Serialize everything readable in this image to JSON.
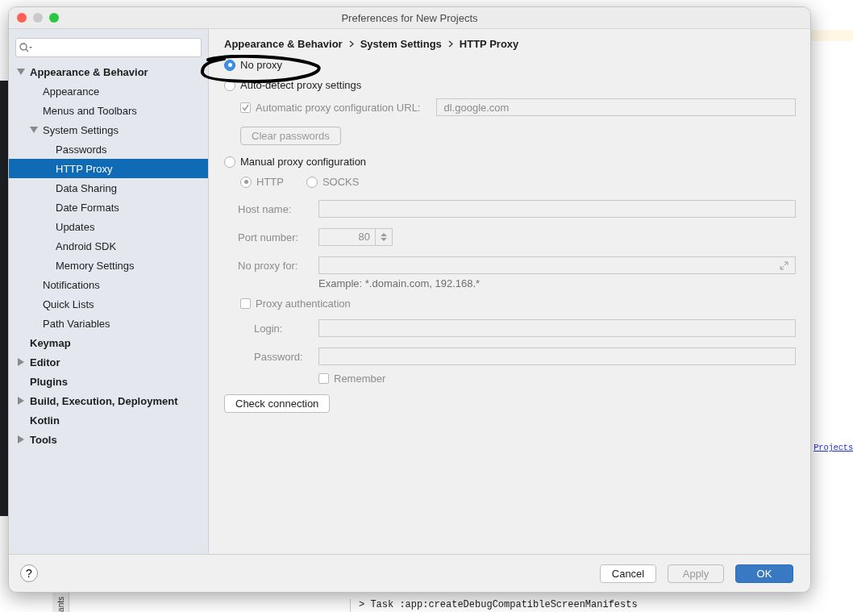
{
  "window": {
    "title": "Preferences for New Projects"
  },
  "sidebar": {
    "items": [
      {
        "label": "Appearance & Behavior",
        "selected": false,
        "expanded": true,
        "children": [
          {
            "label": "Appearance",
            "selected": false
          },
          {
            "label": "Menus and Toolbars",
            "selected": false
          },
          {
            "label": "System Settings",
            "selected": false,
            "expanded": true,
            "children": [
              {
                "label": "Passwords",
                "selected": false
              },
              {
                "label": "HTTP Proxy",
                "selected": true
              },
              {
                "label": "Data Sharing",
                "selected": false
              },
              {
                "label": "Date Formats",
                "selected": false
              },
              {
                "label": "Updates",
                "selected": false
              },
              {
                "label": "Android SDK",
                "selected": false
              },
              {
                "label": "Memory Settings",
                "selected": false
              }
            ]
          },
          {
            "label": "Notifications",
            "selected": false
          },
          {
            "label": "Quick Lists",
            "selected": false
          },
          {
            "label": "Path Variables",
            "selected": false
          }
        ]
      },
      {
        "label": "Keymap",
        "selected": false
      },
      {
        "label": "Editor",
        "selected": false,
        "expanded": false
      },
      {
        "label": "Plugins",
        "selected": false
      },
      {
        "label": "Build, Execution, Deployment",
        "selected": false,
        "expanded": false
      },
      {
        "label": "Kotlin",
        "selected": false
      },
      {
        "label": "Tools",
        "selected": false,
        "expanded": false
      }
    ]
  },
  "breadcrumb": [
    "Appearance & Behavior",
    "System Settings",
    "HTTP Proxy"
  ],
  "proxy_modes": [
    {
      "label": "No proxy",
      "selected": true
    },
    {
      "label": "Auto-detect proxy settings",
      "selected": false
    },
    {
      "label": "Manual proxy configuration",
      "selected": false
    }
  ],
  "auto_detect": {
    "disabled": true,
    "url_checkbox": {
      "label": "Automatic proxy configuration URL:",
      "checked": true
    },
    "url": {
      "value": "dl.google.com"
    },
    "clear_button": "Clear passwords"
  },
  "manual": {
    "disabled": true,
    "protocols": [
      {
        "label": "HTTP",
        "selected": true
      },
      {
        "label": "SOCKS",
        "selected": false
      }
    ],
    "host": {
      "label": "Host name:"
    },
    "port": {
      "label": "Port number:",
      "value": "80"
    },
    "no_proxy": {
      "label": "No proxy for:"
    },
    "example": "Example: *.domain.com, 192.168.*",
    "auth": {
      "label": "Proxy authentication",
      "checked": false
    },
    "login": {
      "label": "Login:"
    },
    "password": {
      "label": "Password:"
    },
    "remember": {
      "label": "Remember",
      "checked": false
    }
  },
  "check_button": "Check connection",
  "help": "?",
  "buttons": [
    {
      "label": "Cancel",
      "kind": "default"
    },
    {
      "label": "Apply",
      "kind": "disabled"
    },
    {
      "label": "OK",
      "kind": "primary"
    }
  ],
  "background": {
    "link": "Projects",
    "side_tab": "ants",
    "console_line": "> Task :app:createDebugCompatibleScreenManifests"
  }
}
